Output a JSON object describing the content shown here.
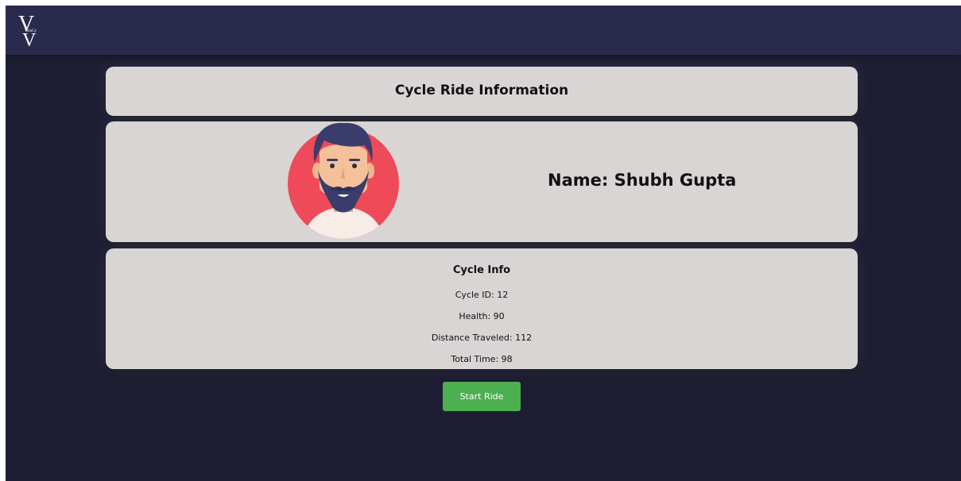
{
  "header": {
    "logo_letter": "V",
    "logo_small_text": "VeloCy"
  },
  "title_card": {
    "title": "Cycle Ride Information"
  },
  "profile": {
    "name_text": "Name: Shubh Gupta",
    "avatar_icon": "user-avatar-bearded-man"
  },
  "cycle_info": {
    "heading": "Cycle Info",
    "cycle_id": "Cycle ID: 12",
    "health": "Health: 90",
    "distance": "Distance Traveled: 112",
    "total_time": "Total Time: 98"
  },
  "actions": {
    "start_ride_label": "Start Ride"
  },
  "colors": {
    "page_background": "#1d1e33",
    "navbar_background": "#2a2b4c",
    "card_background": "#d8d5d4",
    "button_background": "#4caf50",
    "avatar_circle": "#ef4a5a"
  }
}
